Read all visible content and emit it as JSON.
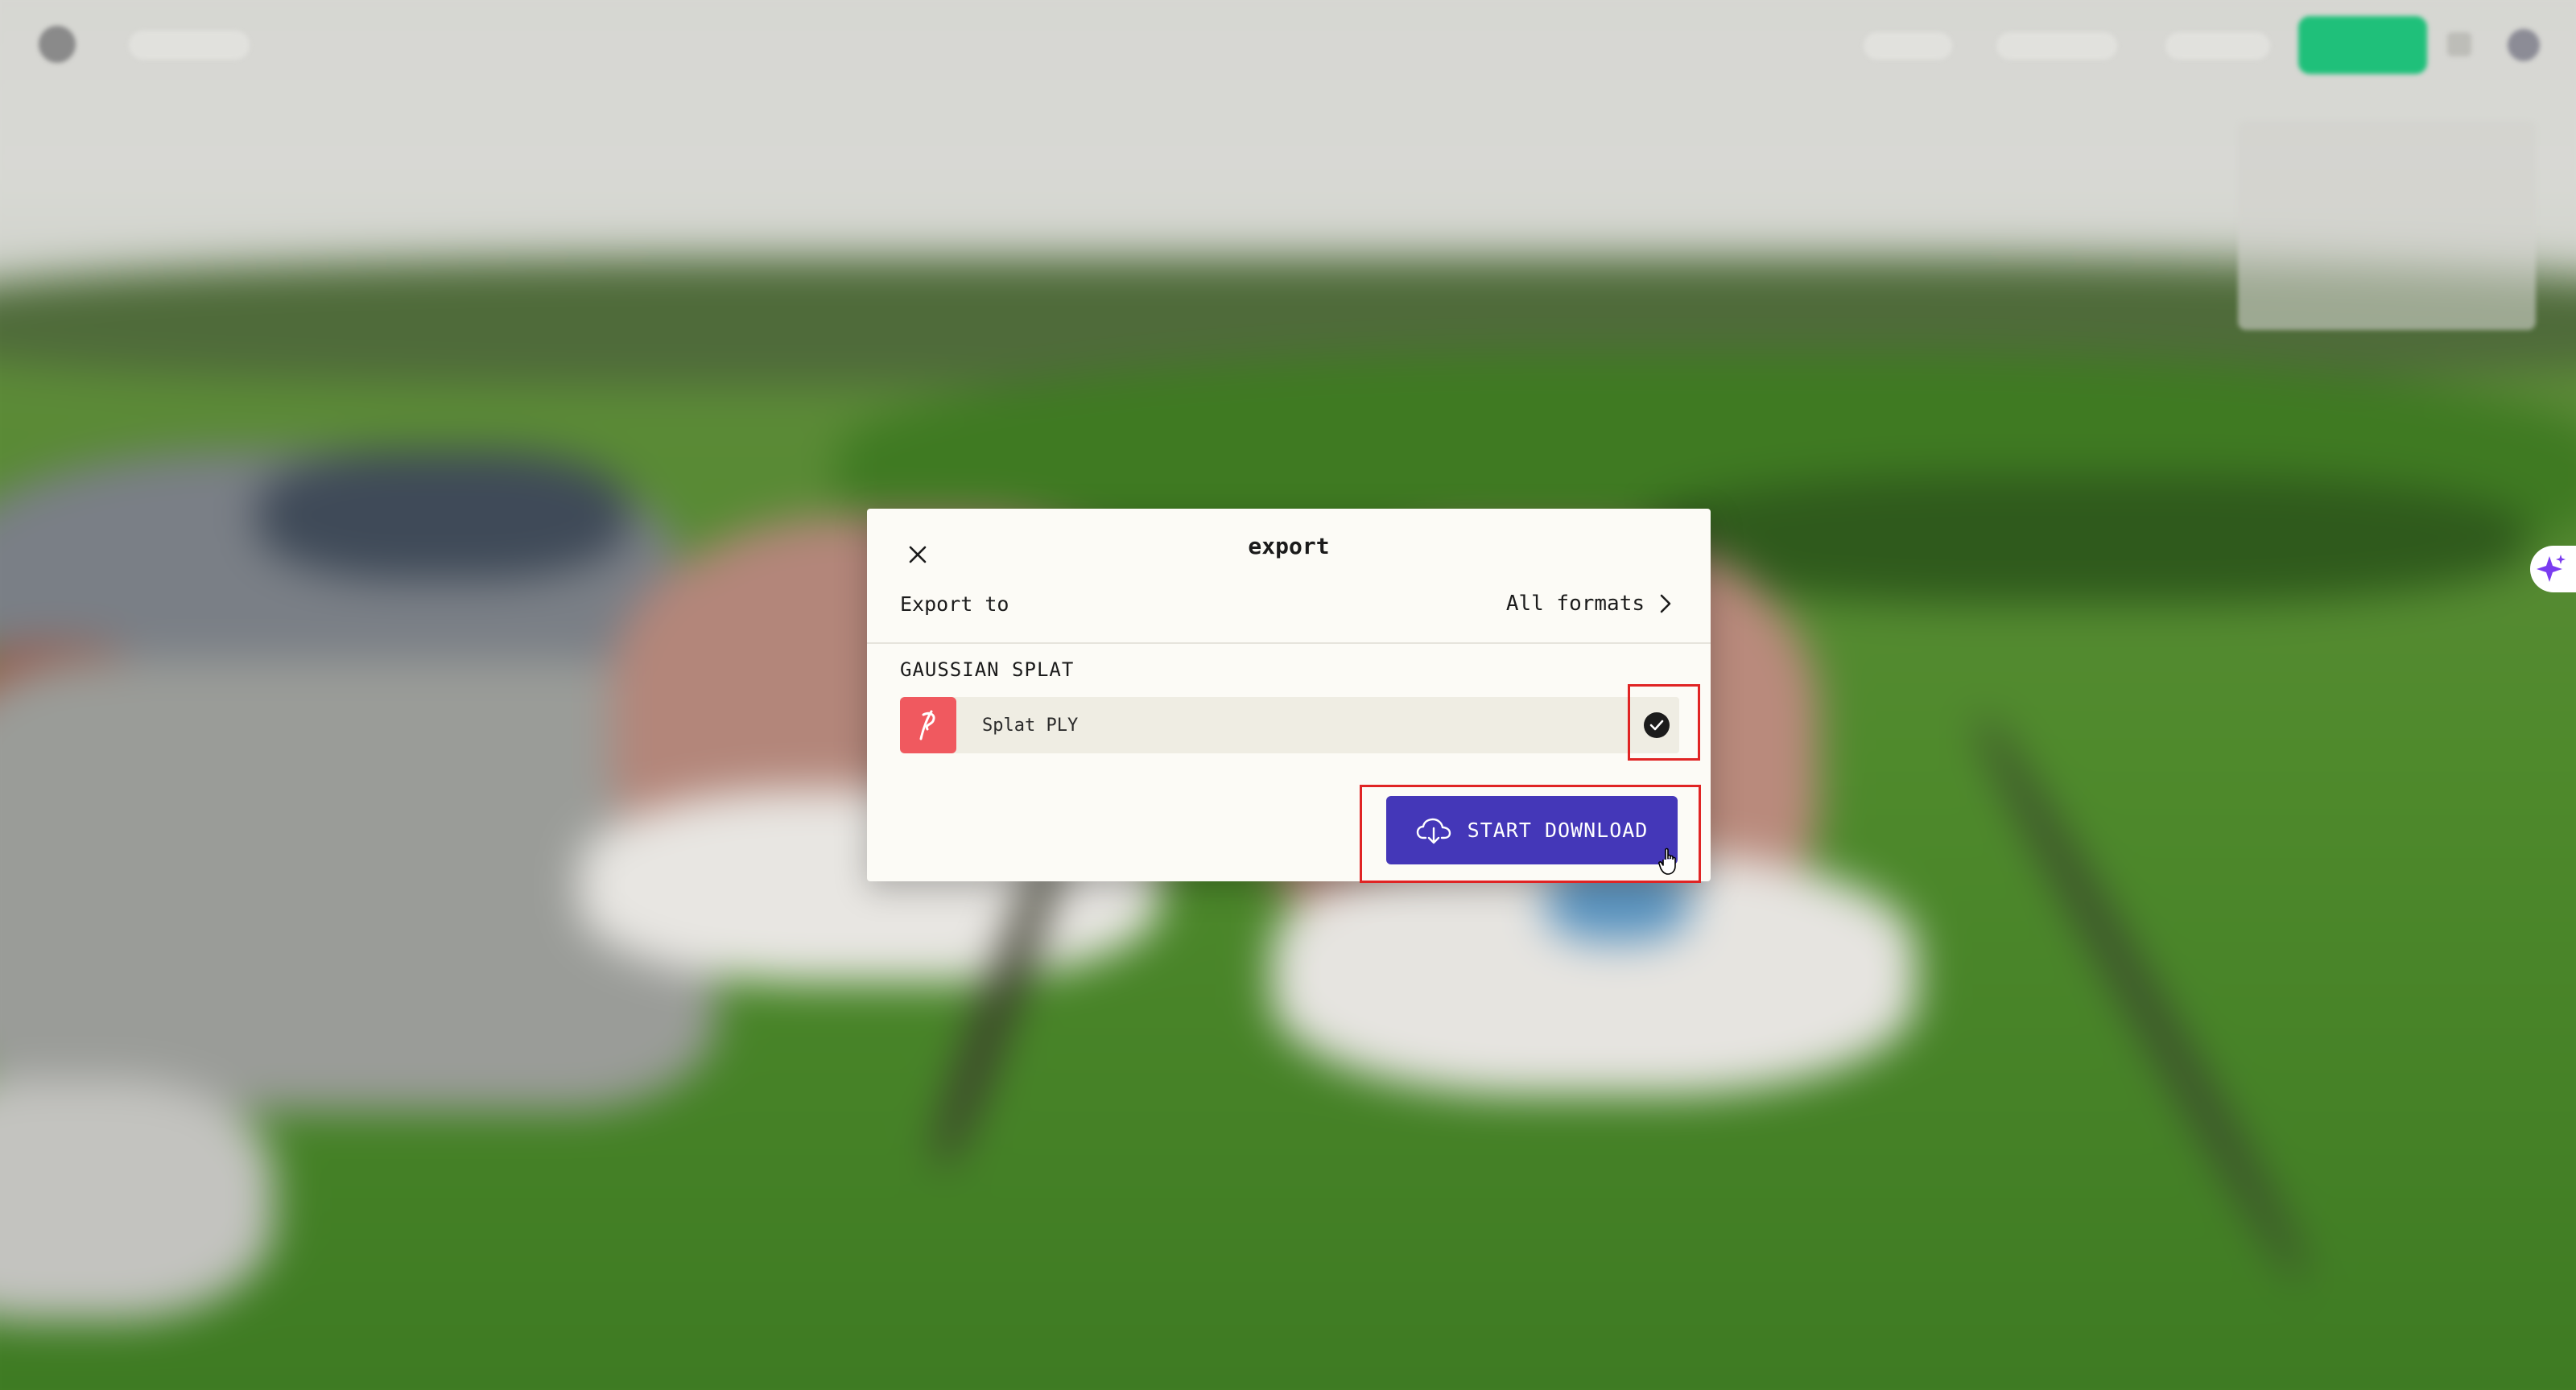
{
  "dialog": {
    "title": "export",
    "close_icon": "close-icon",
    "export_to_label": "Export to",
    "formats_link": "All formats",
    "formats_icon": "chevron-right-icon",
    "section_label": "GAUSSIAN SPLAT",
    "format_item": {
      "label": "Splat PLY",
      "icon": "splat-icon",
      "selected": true
    },
    "download_button": {
      "label": "START DOWNLOAD",
      "icon": "cloud-download-icon"
    }
  },
  "colors": {
    "dialog_bg": "#fcfbf6",
    "row_bg": "#efede3",
    "format_icon_bg": "#f0595f",
    "primary_button": "#4437b8",
    "highlight_box": "#e02424",
    "top_bar_cta": "#1fc07a",
    "sparkle": "#7a3cf0"
  },
  "side_widget": {
    "icon": "sparkle-icon"
  }
}
